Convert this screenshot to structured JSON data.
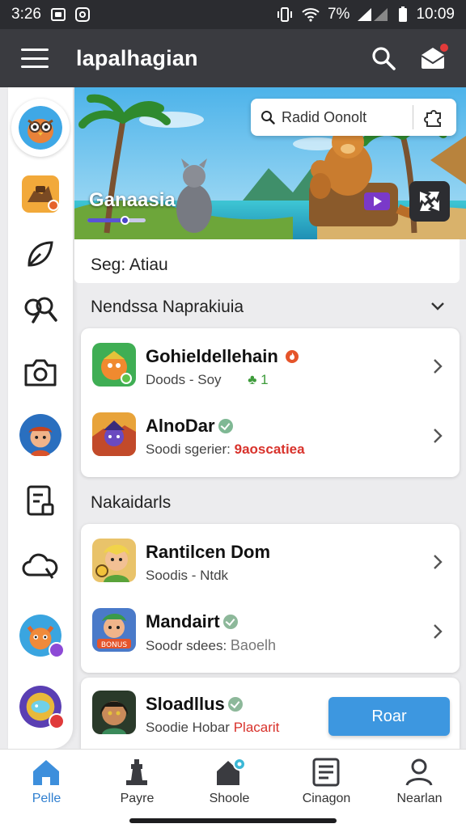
{
  "status_bar": {
    "time_left": "3:26",
    "battery": "7%",
    "time_right": "10:09"
  },
  "app": {
    "title": "lapalhagian",
    "accent": "#3d97e0"
  },
  "hero": {
    "search_text": "Radid Oonolt",
    "title": "Ganaasia",
    "progress": 0.64
  },
  "subhead": "Seg: Atiau",
  "section1": {
    "title": "Nendssa Naprakiuia",
    "items": [
      {
        "title": "Gohieldellehain",
        "sub_text": "Doods - Soy",
        "sub_accent": "1",
        "badge": "fire-icon"
      },
      {
        "title": "AlnoDar",
        "sub_text": "Soodi sgerier:",
        "sub_accent": "9aoscatiea",
        "badge": "verified-icon"
      }
    ]
  },
  "section2": {
    "title": "Nakaidarls",
    "items": [
      {
        "title": "Rantilcen Dom",
        "sub_text": "Soodis - Ntdk",
        "sub_accent": ""
      },
      {
        "title": "Mandairt",
        "sub_text": "Soodr sdees:",
        "sub_accent": "Baoelh",
        "badge": "verified-icon"
      },
      {
        "title": "Sloadllus",
        "sub_text": "Soodie Hobar",
        "sub_accent": "Placarit",
        "badge": "verified-icon"
      }
    ]
  },
  "roar_button": "Roar",
  "bottom_nav": [
    {
      "label": "Pelle",
      "icon": "home-icon",
      "active": true
    },
    {
      "label": "Payre",
      "icon": "chess-piece-icon",
      "active": false
    },
    {
      "label": "Shoole",
      "icon": "house-badge-icon",
      "active": false
    },
    {
      "label": "Cinagon",
      "icon": "list-icon",
      "active": false
    },
    {
      "label": "Nearlan",
      "icon": "person-icon",
      "active": false
    }
  ]
}
